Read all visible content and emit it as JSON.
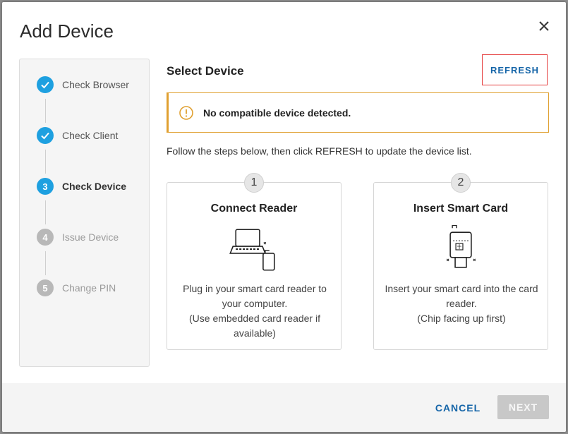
{
  "dialog": {
    "title": "Add Device"
  },
  "stepper": {
    "steps": [
      {
        "number": "1",
        "label": "Check Browser",
        "state": "done"
      },
      {
        "number": "2",
        "label": "Check Client",
        "state": "done"
      },
      {
        "number": "3",
        "label": "Check Device",
        "state": "active"
      },
      {
        "number": "4",
        "label": "Issue Device",
        "state": "pending"
      },
      {
        "number": "5",
        "label": "Change PIN",
        "state": "pending"
      }
    ]
  },
  "main": {
    "section_title": "Select Device",
    "refresh_label": "REFRESH",
    "alert_text": "No compatible device detected.",
    "instructions": "Follow the steps below, then click REFRESH to update the device list.",
    "cards": [
      {
        "number": "1",
        "title": "Connect Reader",
        "desc_line1": "Plug in your smart card reader to your computer.",
        "desc_line2": "(Use embedded card reader if available)"
      },
      {
        "number": "2",
        "title": "Insert Smart Card",
        "desc_line1": "Insert your smart card into the card reader.",
        "desc_line2": "(Chip facing up first)"
      }
    ]
  },
  "footer": {
    "cancel_label": "CANCEL",
    "next_label": "NEXT"
  },
  "colors": {
    "accent": "#1ea0e0",
    "link": "#1565a8",
    "warning": "#e0a030",
    "refresh_focus": "#e53e3e",
    "disabled": "#c8c8c8"
  },
  "icons": [
    "close-icon",
    "check-icon",
    "warning-icon",
    "laptop-reader-icon",
    "smart-card-reader-icon"
  ]
}
